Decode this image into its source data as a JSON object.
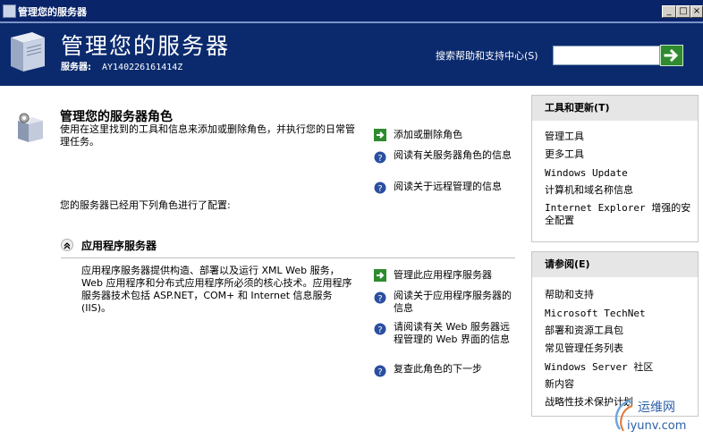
{
  "window": {
    "title": "管理您的服务器"
  },
  "header": {
    "title": "管理您的服务器",
    "server_label": "服务器:",
    "server_name": "AY140226161414Z",
    "search_label": "搜索帮助和支持中心(S)",
    "search_value": ""
  },
  "main": {
    "title": "管理您的服务器角色",
    "description": "使用在这里找到的工具和信息来添加或删除角色，并执行您的日常管理任务。",
    "links": [
      {
        "label": "添加或删除角色",
        "icon": "green-arrow-icon"
      },
      {
        "label": "阅读有关服务器角色的信息",
        "icon": "help-icon"
      },
      {
        "label": "阅读关于远程管理的信息",
        "icon": "help-icon"
      }
    ],
    "configured_text": "您的服务器已经用下列角色进行了配置:"
  },
  "role": {
    "title": "应用程序服务器",
    "description": "应用程序服务器提供构造、部署以及运行 XML Web 服务，Web 应用程序和分布式应用程序所必须的核心技术。应用程序服务器技术包括 ASP.NET，COM+ 和 Internet 信息服务(IIS)。",
    "links": [
      {
        "label": "管理此应用程序服务器",
        "icon": "green-arrow-icon"
      },
      {
        "label": "阅读关于应用程序服务器的信息",
        "icon": "help-icon"
      },
      {
        "label": "请阅读有关 Web 服务器远程管理的 Web 界面的信息",
        "icon": "help-icon"
      },
      {
        "label": "复查此角色的下一步",
        "icon": "help-icon"
      }
    ]
  },
  "tools_panel": {
    "title": "工具和更新(T)",
    "items": [
      "管理工具",
      "更多工具",
      "Windows Update",
      "计算机和域名称信息",
      "Internet Explorer 增强的安全配置"
    ]
  },
  "see_also_panel": {
    "title": "请参阅(E)",
    "items": [
      "帮助和支持",
      "Microsoft TechNet",
      "部署和资源工具包",
      "常见管理任务列表",
      "Windows Server 社区",
      "新内容",
      "战略性技术保护计划"
    ]
  },
  "watermark": {
    "text1": "运维网",
    "text2": "iyunv.com"
  },
  "colors": {
    "header_bg": "#0b2a6e",
    "title_bg": "#0a246a",
    "go_green": "#2e8b2e",
    "panel_head": "#e6e6e6"
  }
}
